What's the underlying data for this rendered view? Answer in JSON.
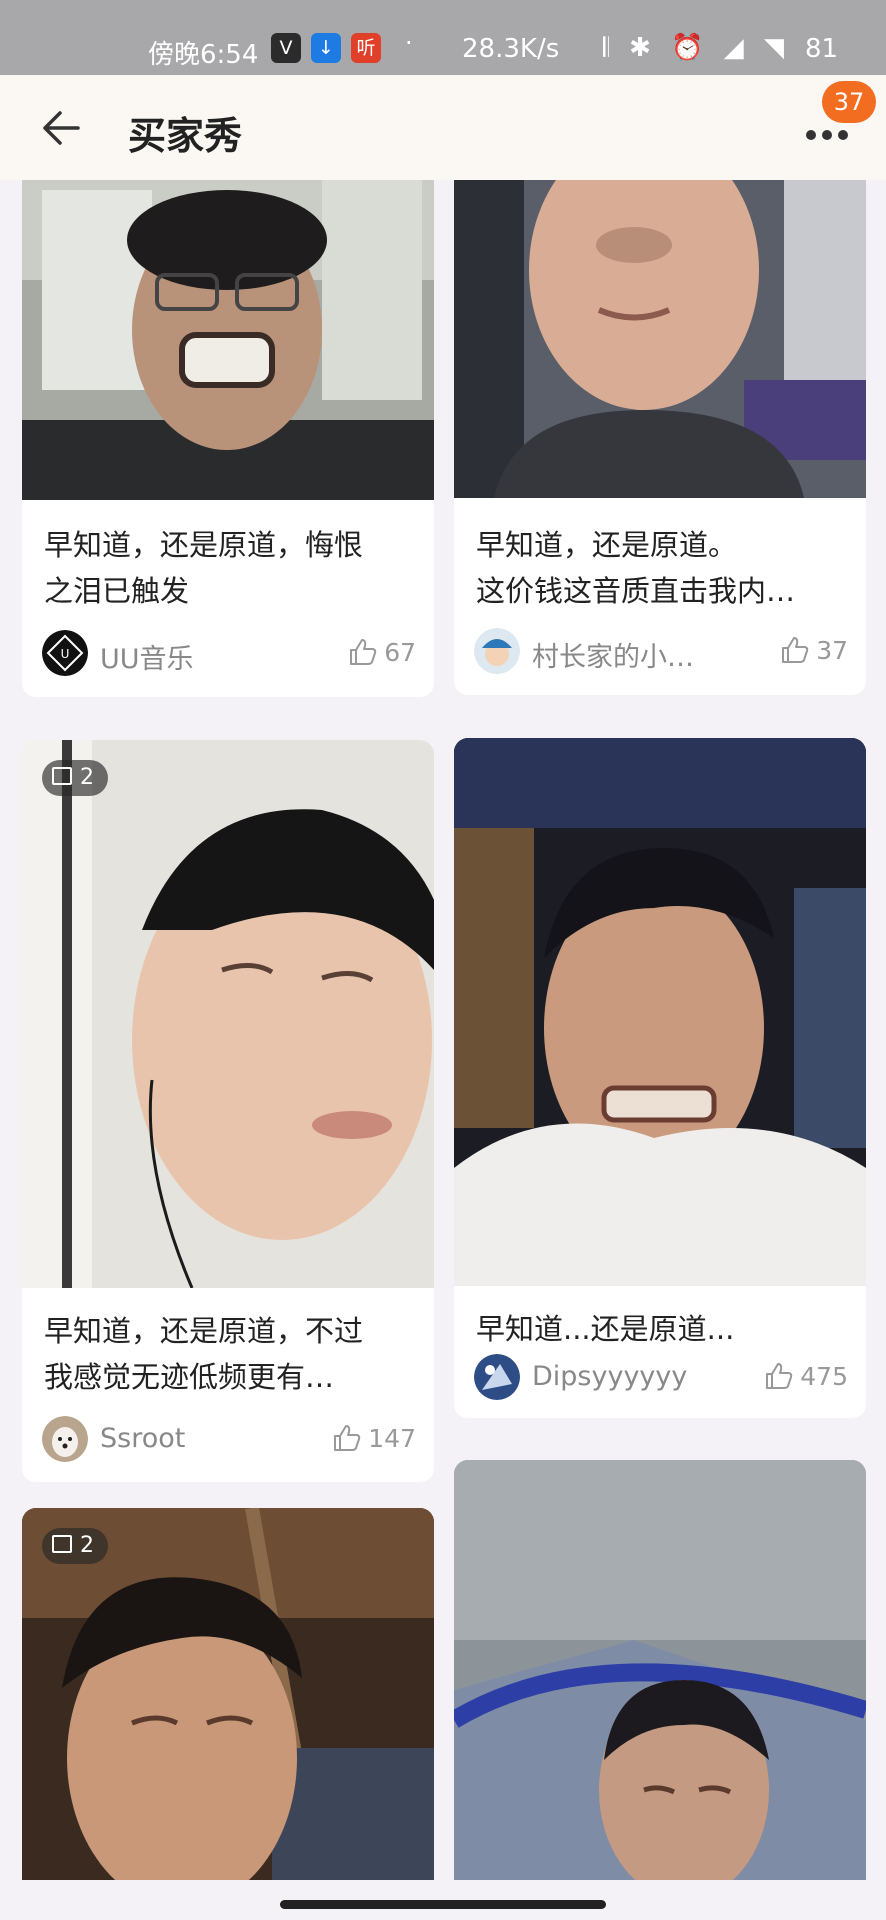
{
  "status_bar": {
    "time": "傍晚6:54",
    "apps": [
      "V",
      "↓",
      "听"
    ],
    "separator": "·",
    "net_rate": "28.3K/s",
    "icons": "𝄃 ✱ ⏰ ◢ ◥",
    "battery": "81"
  },
  "header": {
    "title": "买家秀",
    "badge": "37"
  },
  "colors": {
    "accent": "#f36d21",
    "background": "#f4f2f6"
  },
  "posts": [
    {
      "caption_lines": [
        "早知道，还是原道，悔恨",
        "之泪已触发"
      ],
      "user": "UU音乐",
      "likes": "67"
    },
    {
      "caption_lines": [
        "早知道，还是原道。",
        "这价钱这音质直击我内…"
      ],
      "user": "村长家的小…",
      "likes": "37"
    },
    {
      "image_count": "2",
      "caption_lines": [
        "早知道，还是原道，不过",
        "我感觉无迹低频更有…"
      ],
      "user": "Ssroot",
      "likes": "147"
    },
    {
      "caption_lines": [
        "早知道...还是原道..."
      ],
      "user": "Dipsyyyyyy",
      "likes": "475"
    },
    {
      "image_count": "2"
    },
    {}
  ]
}
